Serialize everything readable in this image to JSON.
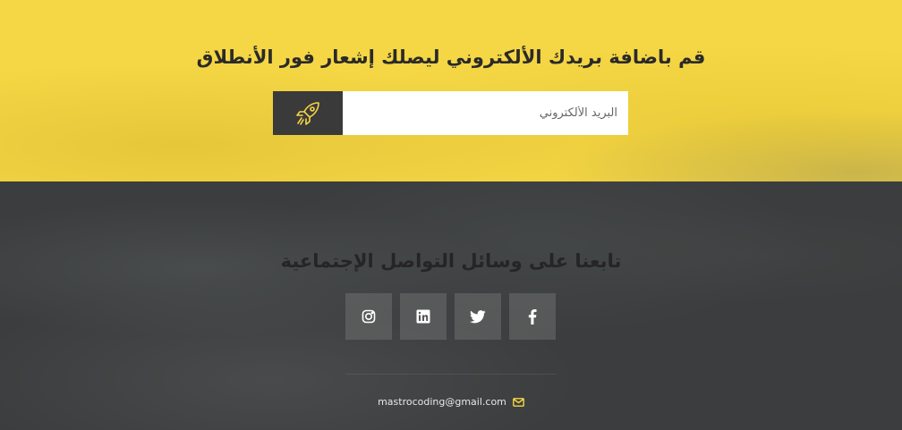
{
  "newsletter": {
    "title": "قم باضافة بريدك الألكتروني ليصلك إشعار فور الأنطلاق",
    "email_placeholder": "البريد الألكتروني",
    "submit_icon": "rocket-icon"
  },
  "footer": {
    "social_title": "تابعنا على وسائل التواصل الإجتماعية",
    "social_links": [
      {
        "name": "instagram",
        "icon": "instagram-icon"
      },
      {
        "name": "linkedin",
        "icon": "linkedin-icon"
      },
      {
        "name": "twitter",
        "icon": "twitter-icon"
      },
      {
        "name": "facebook",
        "icon": "facebook-icon"
      }
    ],
    "email": "mastrocoding@gmail.com",
    "email_icon": "envelope-icon"
  },
  "colors": {
    "accent": "#f5d644",
    "dark": "#3a3a3a",
    "footer_bg": "#3b3d3e"
  }
}
